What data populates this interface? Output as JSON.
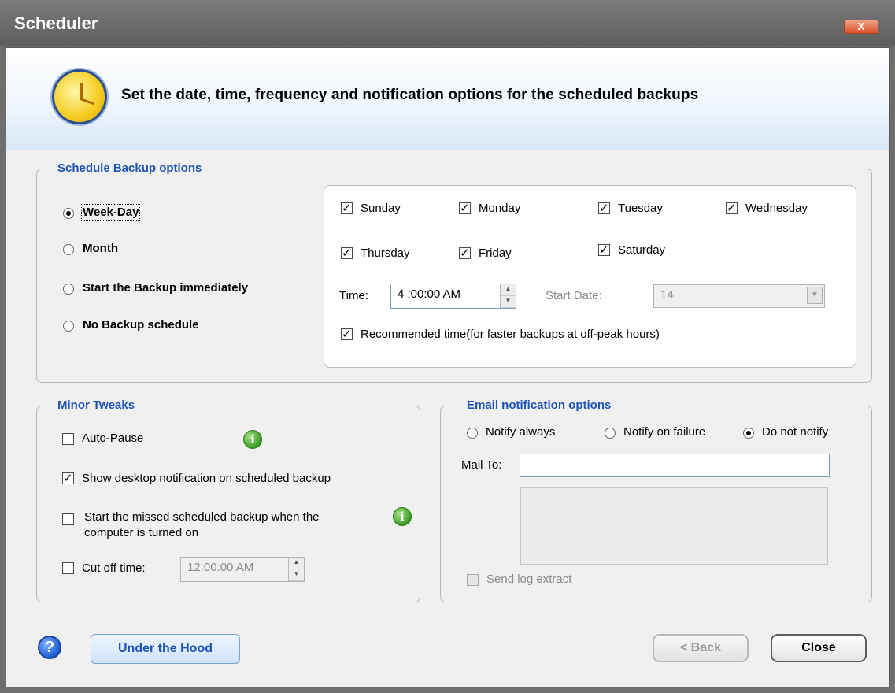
{
  "window": {
    "title": "Scheduler",
    "close_glyph": "X"
  },
  "header": {
    "text": "Set the date, time, frequency and notification options for the scheduled backups",
    "icon": "clock-icon"
  },
  "schedule": {
    "legend": "Schedule Backup options",
    "modes": [
      {
        "label": "Week-Day",
        "selected": true
      },
      {
        "label": "Month",
        "selected": false
      },
      {
        "label": "Start the Backup immediately",
        "selected": false
      },
      {
        "label": "No Backup schedule",
        "selected": false
      }
    ],
    "days": [
      {
        "label": "Sunday",
        "checked": true
      },
      {
        "label": "Monday",
        "checked": true
      },
      {
        "label": "Tuesday",
        "checked": true
      },
      {
        "label": "Wednesday",
        "checked": true
      },
      {
        "label": "Thursday",
        "checked": true
      },
      {
        "label": "Friday",
        "checked": true
      },
      {
        "label": "Saturday",
        "checked": true
      }
    ],
    "time_label": "Time:",
    "time_value": "4 :00:00 AM",
    "start_date_label": "Start Date:",
    "start_date_value": "14",
    "recommended_label": "Recommended time(for faster backups at off-peak hours)",
    "recommended_checked": true
  },
  "tweaks": {
    "legend": "Minor Tweaks",
    "auto_pause": {
      "label": "Auto-Pause",
      "checked": false
    },
    "desktop_notification": {
      "label": "Show desktop notification on scheduled backup",
      "checked": true
    },
    "missed_backup": {
      "label_line1": "Start the missed scheduled backup when the",
      "label_line2": "computer is turned on",
      "checked": false
    },
    "cutoff": {
      "label": "Cut off time:",
      "value": "12:00:00 AM",
      "checked": false
    }
  },
  "email": {
    "legend": "Email notification options",
    "options": [
      {
        "label": "Notify always",
        "selected": false
      },
      {
        "label": "Notify on failure",
        "selected": false
      },
      {
        "label": "Do not notify",
        "selected": true
      }
    ],
    "mail_to_label": "Mail To:",
    "mail_to_value": "",
    "send_log_label": "Send log extract"
  },
  "footer": {
    "help_glyph": "?",
    "under_hood_label": "Under the Hood",
    "back_label": "< Back",
    "close_label": "Close"
  }
}
